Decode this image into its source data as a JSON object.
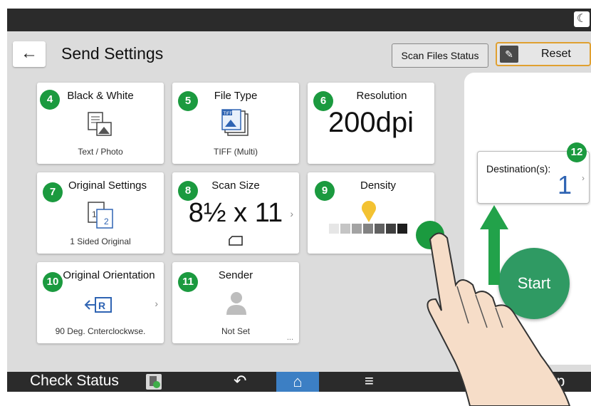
{
  "header": {
    "back_icon": "←",
    "title": "Send Settings",
    "scan_status": "Scan Files Status",
    "reset": "Reset",
    "reset_icon": "✎"
  },
  "topbar": {
    "moon_icon": "☾"
  },
  "tiles": {
    "color_mode": {
      "badge": "4",
      "label": "Black & White",
      "value": "Text / Photo"
    },
    "file_type": {
      "badge": "5",
      "label": "File Type",
      "value": "TIFF (Multi)",
      "icon_text": "TIFF"
    },
    "resolution": {
      "badge": "6",
      "label": "Resolution",
      "value": "200dpi"
    },
    "original_settings": {
      "badge": "7",
      "label": "Original Settings",
      "value": "1 Sided Original",
      "icon_num1": "1",
      "icon_num2": "2"
    },
    "scan_size": {
      "badge": "8",
      "label": "Scan Size",
      "value": "8½ x 11",
      "chevron": "›"
    },
    "density": {
      "badge": "9",
      "label": "Density",
      "level": 4,
      "levels": 7
    },
    "orientation": {
      "badge": "10",
      "label": "Original Orientation",
      "value": "90 Deg. Cnterclockwse.",
      "chevron": "›"
    },
    "sender": {
      "badge": "11",
      "label": "Sender",
      "value": "Not Set",
      "more": "..."
    }
  },
  "destination": {
    "badge": "12",
    "label": "Destination(s):",
    "count": "1",
    "chevron": "›"
  },
  "start": {
    "label": "Start"
  },
  "bottom": {
    "check_status": "Check Status",
    "back_icon": "↶",
    "home_icon": "⌂",
    "menu_icon": "≡",
    "app_partial": "pp"
  },
  "colors": {
    "badge": "#1b9a3f",
    "start": "#2f9a63",
    "arrow": "#22a24a",
    "home": "#3c7fc4",
    "hand": "#f6ddc8",
    "dot": "#f3c232"
  }
}
